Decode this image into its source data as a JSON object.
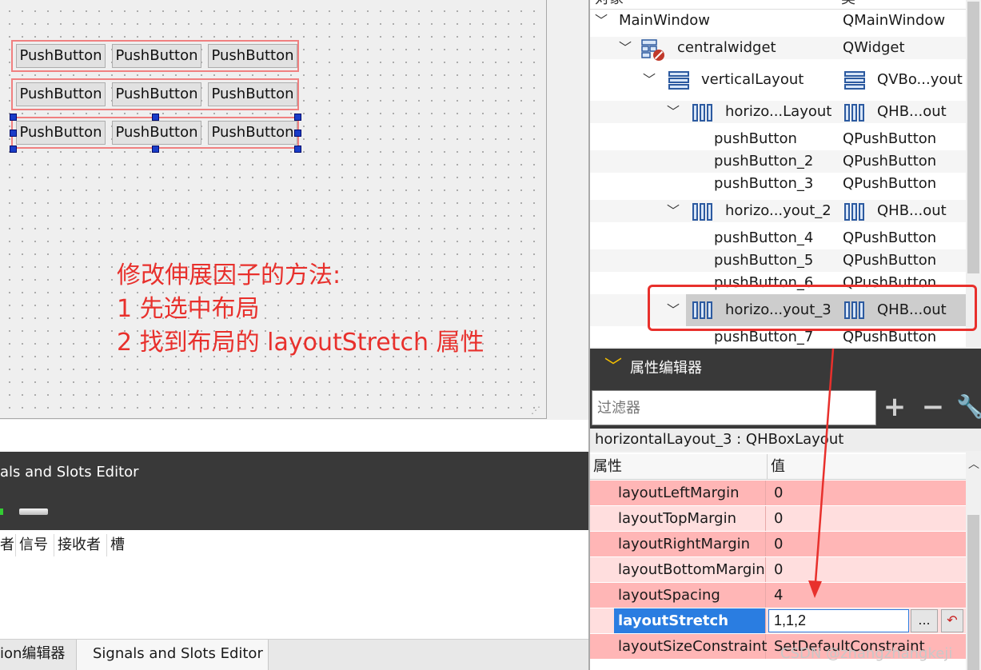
{
  "canvas": {
    "buttons": [
      [
        "PushButton",
        "PushButton",
        "PushButton"
      ],
      [
        "PushButton",
        "PushButton",
        "PushButton"
      ],
      [
        "PushButton",
        "PushButton",
        "PushButton"
      ]
    ],
    "annotation": [
      "修改伸展因子的方法:",
      "1 先选中布局",
      "2 找到布局的 layoutStretch 属性"
    ],
    "annotation_color": "#e8302c"
  },
  "signals_slots": {
    "title": "als and Slots Editor",
    "columns": [
      "者",
      "信号",
      "接收者",
      "槽"
    ],
    "tabs": [
      "ion编辑器",
      "Signals and Slots Editor"
    ]
  },
  "object_inspector": {
    "header": [
      "对象",
      "类"
    ],
    "rows": [
      {
        "name": "MainWindow",
        "class": "QMainWindow",
        "level": 0,
        "expanded": true,
        "icon": "none"
      },
      {
        "name": "centralwidget",
        "class": "QWidget",
        "level": 1,
        "expanded": true,
        "icon": "widget-broken-layout-icon"
      },
      {
        "name": "verticalLayout",
        "class": "QVBo...yout",
        "level": 2,
        "expanded": true,
        "icon": "vbox-layout-icon"
      },
      {
        "name": "horizo...Layout",
        "class": "QHB...out",
        "level": 3,
        "expanded": true,
        "icon": "hbox-layout-icon"
      },
      {
        "name": "pushButton",
        "class": "QPushButton",
        "level": 4,
        "icon": "none"
      },
      {
        "name": "pushButton_2",
        "class": "QPushButton",
        "level": 4,
        "icon": "none"
      },
      {
        "name": "pushButton_3",
        "class": "QPushButton",
        "level": 4,
        "icon": "none"
      },
      {
        "name": "horizo...yout_2",
        "class": "QHB...out",
        "level": 3,
        "expanded": true,
        "icon": "hbox-layout-icon"
      },
      {
        "name": "pushButton_4",
        "class": "QPushButton",
        "level": 4,
        "icon": "none"
      },
      {
        "name": "pushButton_5",
        "class": "QPushButton",
        "level": 4,
        "icon": "none"
      },
      {
        "name": "pushButton_6",
        "class": "QPushButton",
        "level": 4,
        "icon": "none"
      },
      {
        "name": "horizo...yout_3",
        "class": "QHB...out",
        "level": 3,
        "expanded": true,
        "selected": true,
        "icon": "hbox-layout-icon"
      },
      {
        "name": "pushButton_7",
        "class": "QPushButton",
        "level": 4,
        "icon": "none"
      }
    ]
  },
  "property_editor": {
    "title": "属性编辑器",
    "filter_placeholder": "过滤器",
    "class_label": "horizontalLayout_3 : QHBoxLayout",
    "header": [
      "属性",
      "值"
    ],
    "rows": [
      {
        "name": "layoutLeftMargin",
        "value": "0"
      },
      {
        "name": "layoutTopMargin",
        "value": "0"
      },
      {
        "name": "layoutRightMargin",
        "value": "0"
      },
      {
        "name": "layoutBottomMargin",
        "value": "0"
      },
      {
        "name": "layoutSpacing",
        "value": "4"
      },
      {
        "name": "layoutStretch",
        "value": "1,1,2",
        "editing": true
      },
      {
        "name": "layoutSizeConstraint",
        "value": "SetDefaultConstraint"
      }
    ],
    "edit_button": "...",
    "watermark": "CSDN @zhangzhangkeji"
  }
}
